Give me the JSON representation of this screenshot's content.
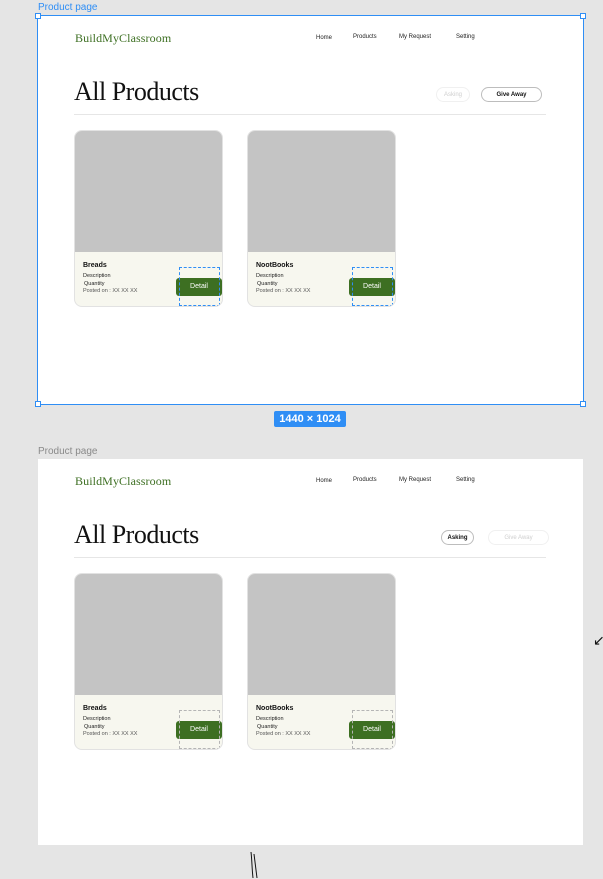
{
  "frame_label": "Product page",
  "size_badge": "1440 × 1024",
  "brand": "BuildMyClassroom",
  "nav": {
    "home": "Home",
    "products": "Products",
    "my_request": "My Request",
    "setting": "Setting"
  },
  "page_title": "All Products",
  "toggles": {
    "asking": "Asking",
    "give_away": "Give Away"
  },
  "frames": [
    {
      "active_toggle": "give_away"
    },
    {
      "active_toggle": "asking"
    }
  ],
  "cards": [
    {
      "name": "Breads",
      "description": "Description",
      "quantity": "Quantity",
      "posted": "Posted on : XX XX XX",
      "button": "Detail"
    },
    {
      "name": "NootBooks",
      "description": "Description",
      "quantity": "Quantity",
      "posted": "Posted on : XX XX XX",
      "button": "Detail"
    }
  ],
  "colors": {
    "brand_green": "#3d6f22",
    "selection_blue": "#2f8ef5",
    "card_image": "#c4c4c4"
  }
}
